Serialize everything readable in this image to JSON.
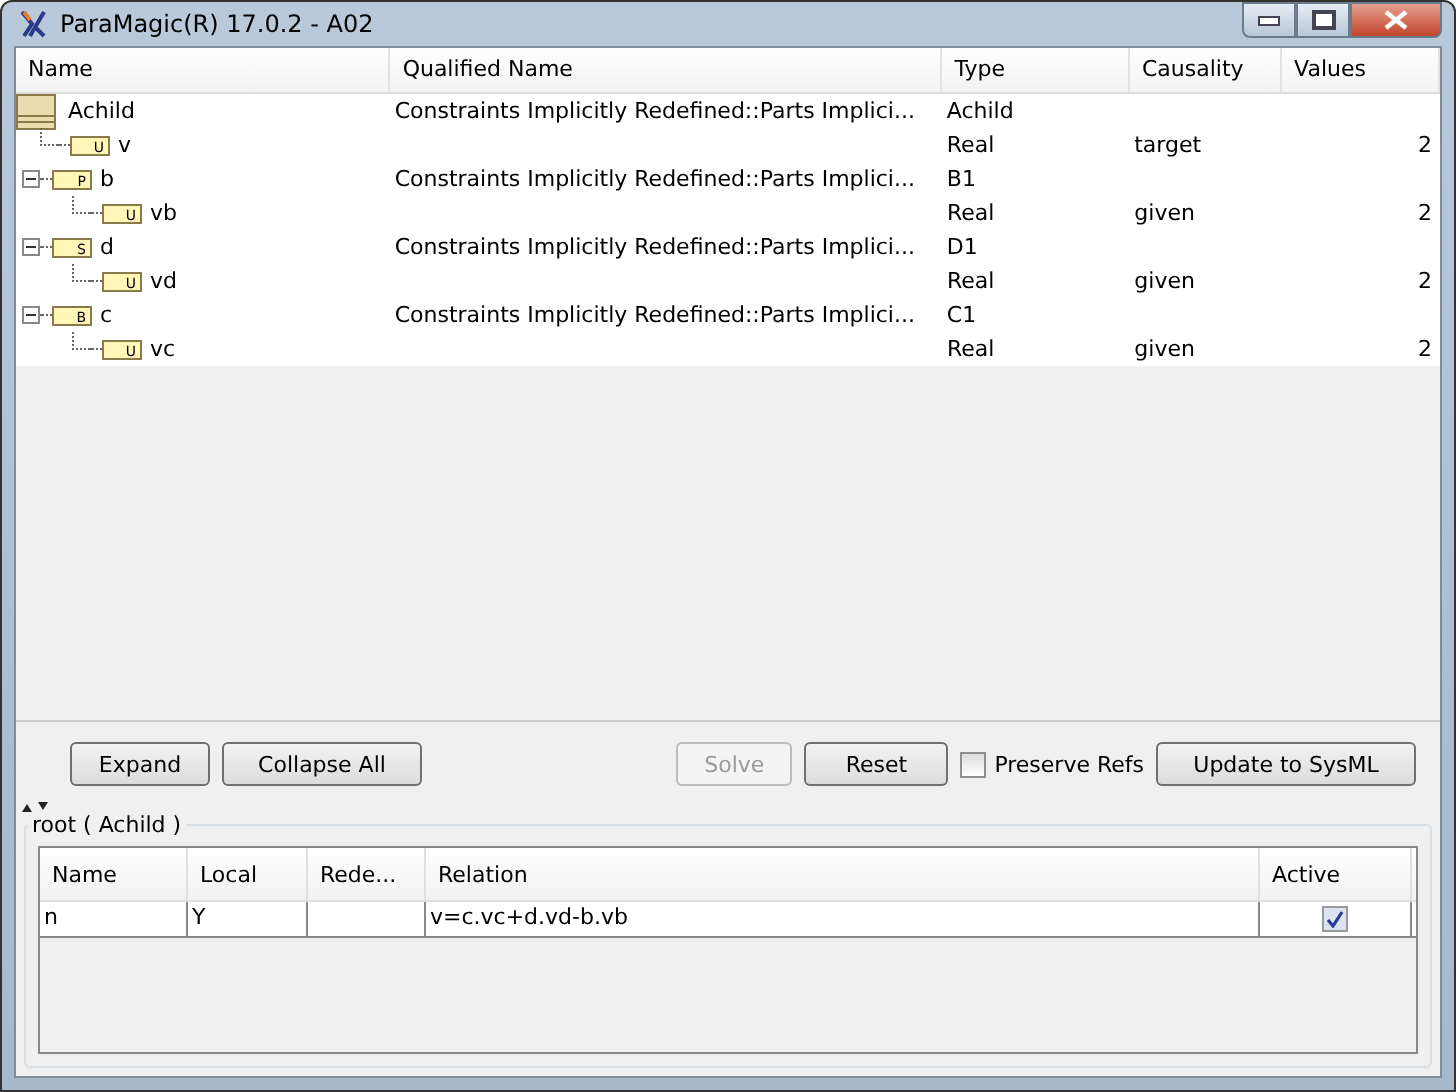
{
  "window": {
    "title": "ParaMagic(R) 17.0.2 - A02"
  },
  "tree": {
    "columns": [
      "Name",
      "Qualified Name",
      "Type",
      "Causality",
      "Values"
    ],
    "nodes": [
      {
        "kind": "root",
        "name": "Achild",
        "qualified_name": "Constraints Implicitly Redefined::Parts Implici...",
        "type": "Achild",
        "children": [
          {
            "kind": "item",
            "badge": "U",
            "name": "v",
            "type": "Real",
            "causality": "target",
            "value": "2"
          },
          {
            "kind": "item",
            "badge": "P",
            "name": "b",
            "qualified_name": "Constraints Implicitly Redefined::Parts Implici...",
            "type": "B1",
            "expanded": true,
            "children": [
              {
                "kind": "item",
                "badge": "U",
                "name": "vb",
                "type": "Real",
                "causality": "given",
                "value": "2"
              }
            ]
          },
          {
            "kind": "item",
            "badge": "S",
            "name": "d",
            "qualified_name": "Constraints Implicitly Redefined::Parts Implici...",
            "type": "D1",
            "expanded": true,
            "children": [
              {
                "kind": "item",
                "badge": "U",
                "name": "vd",
                "type": "Real",
                "causality": "given",
                "value": "2"
              }
            ]
          },
          {
            "kind": "item",
            "badge": "B",
            "name": "c",
            "qualified_name": "Constraints Implicitly Redefined::Parts Implici...",
            "type": "C1",
            "expanded": true,
            "children": [
              {
                "kind": "item",
                "badge": "U",
                "name": "vc",
                "type": "Real",
                "causality": "given",
                "value": "2"
              }
            ]
          }
        ]
      }
    ]
  },
  "buttons": {
    "expand": "Expand",
    "collapse_all": "Collapse All",
    "solve": {
      "label": "Solve",
      "disabled": true
    },
    "reset": "Reset",
    "preserve_refs": {
      "label": "Preserve Refs",
      "checked": false
    },
    "update": "Update to SysML"
  },
  "relations": {
    "title": "root ( Achild )",
    "columns": [
      "Name",
      "Local",
      "Rede...",
      "Relation",
      "Active"
    ],
    "rows": [
      {
        "name": "n",
        "local": "Y",
        "relation": "v=c.vc+d.vd-b.vb",
        "active": true
      }
    ]
  }
}
